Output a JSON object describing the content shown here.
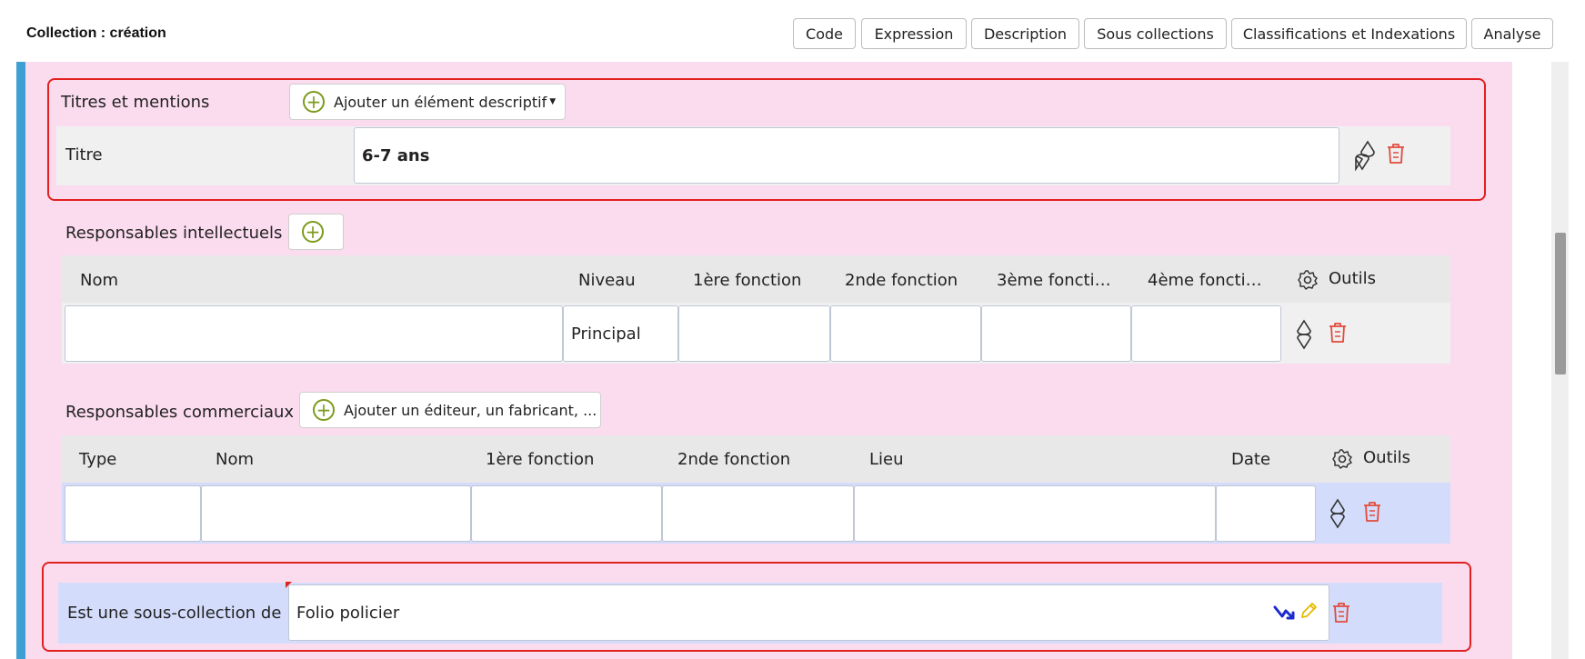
{
  "page": {
    "title": "Collection : création"
  },
  "tabs": [
    {
      "label": "Code"
    },
    {
      "label": "Expression"
    },
    {
      "label": "Description"
    },
    {
      "label": "Sous collections"
    },
    {
      "label": "Classifications et Indexations"
    },
    {
      "label": "Analyse"
    }
  ],
  "titres": {
    "section_label": "Titres et mentions",
    "add_button": "Ajouter un élément descriptif",
    "row_label": "Titre",
    "value": "6-7 ans"
  },
  "intellectuels": {
    "section_label": "Responsables intellectuels",
    "columns": [
      "Nom",
      "Niveau",
      "1ère fonction",
      "2nde fonction",
      "3ème foncti…",
      "4ème foncti…"
    ],
    "tools_label": "Outils",
    "row": {
      "nom": "",
      "niveau": "Principal",
      "f1": "",
      "f2": "",
      "f3": "",
      "f4": ""
    }
  },
  "commerciaux": {
    "section_label": "Responsables commerciaux",
    "add_button": "Ajouter un éditeur, un fabricant, ...",
    "columns": [
      "Type",
      "Nom",
      "1ère fonction",
      "2nde fonction",
      "Lieu",
      "Date"
    ],
    "tools_label": "Outils",
    "row": {
      "type": "",
      "nom": "",
      "f1": "",
      "f2": "",
      "lieu": "",
      "date": ""
    }
  },
  "sous_collection": {
    "label": "Est une sous-collection de",
    "value": "Folio policier"
  },
  "colors": {
    "accent_pink": "#fbdcef",
    "left_bar": "#3f9fd2",
    "highlight_red": "#e1201f",
    "row_blue": "#d3dcfb",
    "plus_green": "#7c9a1c",
    "trash_red": "#e34a3c"
  },
  "icons": [
    "plus-circle-icon",
    "move-updown-icon",
    "trash-icon",
    "gear-icon",
    "link-arrow-icon",
    "pencil-icon"
  ]
}
